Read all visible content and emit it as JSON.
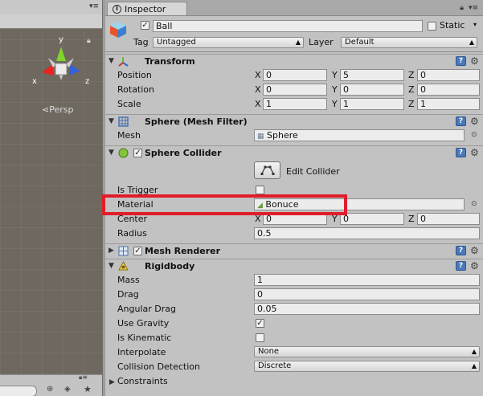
{
  "scene": {
    "persp_label": "⋖Persp",
    "gizmo": {
      "x_label": "x",
      "y_label": "y",
      "z_label": "z"
    }
  },
  "inspector": {
    "tab_title": "Inspector",
    "header": {
      "object_name": "Ball",
      "active_checked": true,
      "static_label": "Static",
      "static_checked": false,
      "tag_label": "Tag",
      "tag_value": "Untagged",
      "layer_label": "Layer",
      "layer_value": "Default"
    },
    "transform": {
      "title": "Transform",
      "rows": [
        {
          "label": "Position",
          "x": "0",
          "y": "5",
          "z": "0"
        },
        {
          "label": "Rotation",
          "x": "0",
          "y": "0",
          "z": "0"
        },
        {
          "label": "Scale",
          "x": "1",
          "y": "1",
          "z": "1"
        }
      ]
    },
    "mesh_filter": {
      "title": "Sphere (Mesh Filter)",
      "mesh_label": "Mesh",
      "mesh_value": "Sphere"
    },
    "sphere_collider": {
      "title": "Sphere Collider",
      "enabled": true,
      "edit_collider_label": "Edit Collider",
      "is_trigger_label": "Is Trigger",
      "is_trigger": false,
      "material_label": "Material",
      "material_value": "Bonuce",
      "center_label": "Center",
      "center": {
        "x": "0",
        "y": "0",
        "z": "0"
      },
      "radius_label": "Radius",
      "radius_value": "0.5"
    },
    "mesh_renderer": {
      "title": "Mesh Renderer",
      "enabled": true
    },
    "rigidbody": {
      "title": "Rigidbody",
      "mass_label": "Mass",
      "mass_value": "1",
      "drag_label": "Drag",
      "drag_value": "0",
      "angular_drag_label": "Angular Drag",
      "angular_drag_value": "0.05",
      "use_gravity_label": "Use Gravity",
      "use_gravity": true,
      "is_kinematic_label": "Is Kinematic",
      "is_kinematic": false,
      "interpolate_label": "Interpolate",
      "interpolate_value": "None",
      "collision_label": "Collision Detection",
      "collision_value": "Discrete",
      "constraints_label": "Constraints"
    },
    "axis_labels": {
      "x": "X",
      "y": "Y",
      "z": "Z"
    },
    "highlight_color": "#e21c2a"
  }
}
